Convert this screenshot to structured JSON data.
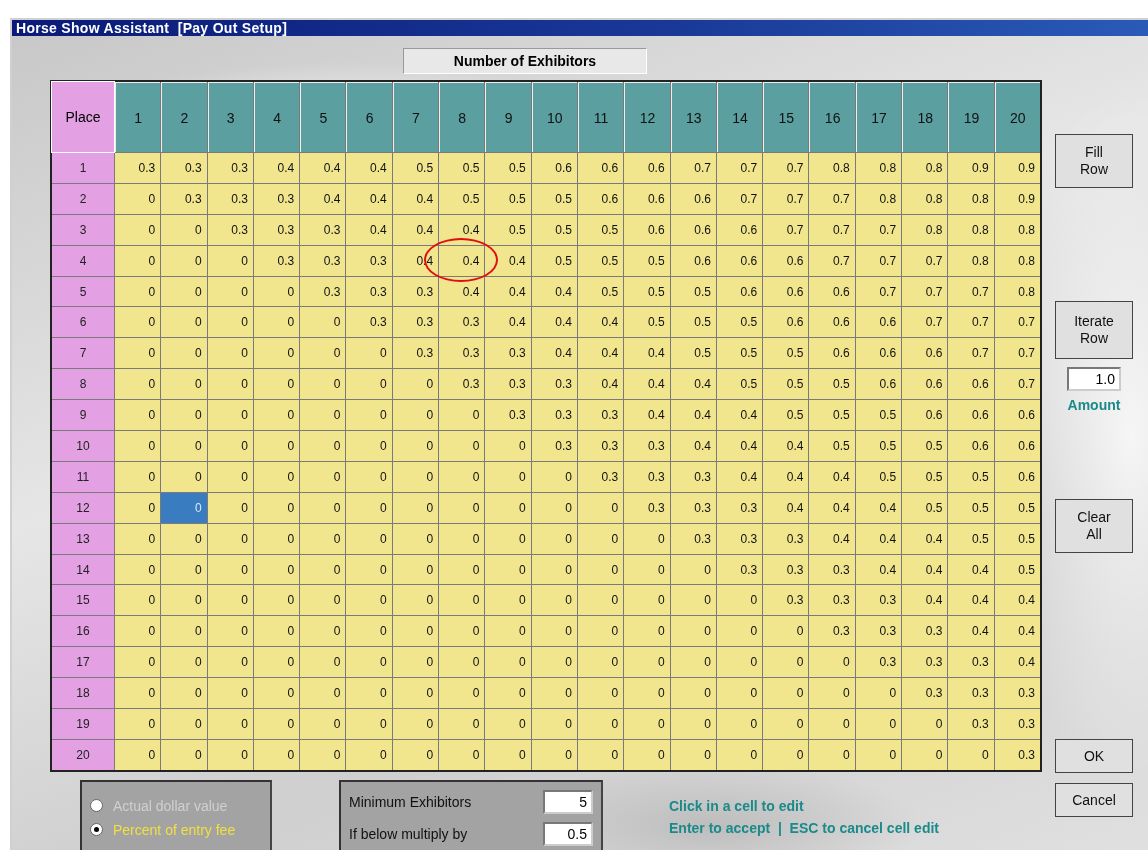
{
  "window": {
    "title": "Horse Show Assistant  [Pay Out Setup]"
  },
  "table": {
    "caption": "Number of Exhibitors",
    "corner": "Place",
    "columns": [
      "1",
      "2",
      "3",
      "4",
      "5",
      "6",
      "7",
      "8",
      "9",
      "10",
      "11",
      "12",
      "13",
      "14",
      "15",
      "16",
      "17",
      "18",
      "19",
      "20"
    ],
    "rows": [
      {
        "place": "1",
        "cells": [
          "0.3",
          "0.3",
          "0.3",
          "0.4",
          "0.4",
          "0.4",
          "0.5",
          "0.5",
          "0.5",
          "0.6",
          "0.6",
          "0.6",
          "0.7",
          "0.7",
          "0.7",
          "0.8",
          "0.8",
          "0.8",
          "0.9",
          "0.9"
        ],
        "selected": [
          false,
          false,
          false,
          false,
          false,
          false,
          false,
          false,
          false,
          false,
          false,
          false,
          false,
          false,
          false,
          false,
          false,
          false,
          false,
          false
        ],
        "circled": [
          false,
          false,
          false,
          false,
          false,
          false,
          false,
          false,
          false,
          false,
          false,
          false,
          false,
          false,
          false,
          false,
          false,
          false,
          false,
          false
        ]
      },
      {
        "place": "2",
        "cells": [
          "0",
          "0.3",
          "0.3",
          "0.3",
          "0.4",
          "0.4",
          "0.4",
          "0.5",
          "0.5",
          "0.5",
          "0.6",
          "0.6",
          "0.6",
          "0.7",
          "0.7",
          "0.7",
          "0.8",
          "0.8",
          "0.8",
          "0.9"
        ],
        "selected": [
          false,
          false,
          false,
          false,
          false,
          false,
          false,
          false,
          false,
          false,
          false,
          false,
          false,
          false,
          false,
          false,
          false,
          false,
          false,
          false
        ],
        "circled": [
          false,
          false,
          false,
          false,
          false,
          false,
          false,
          false,
          false,
          false,
          false,
          false,
          false,
          false,
          false,
          false,
          false,
          false,
          false,
          false
        ]
      },
      {
        "place": "3",
        "cells": [
          "0",
          "0",
          "0.3",
          "0.3",
          "0.3",
          "0.4",
          "0.4",
          "0.4",
          "0.5",
          "0.5",
          "0.5",
          "0.6",
          "0.6",
          "0.6",
          "0.7",
          "0.7",
          "0.7",
          "0.8",
          "0.8",
          "0.8"
        ],
        "selected": [
          false,
          false,
          false,
          false,
          false,
          false,
          false,
          false,
          false,
          false,
          false,
          false,
          false,
          false,
          false,
          false,
          false,
          false,
          false,
          false
        ],
        "circled": [
          false,
          false,
          false,
          false,
          false,
          false,
          false,
          false,
          false,
          false,
          false,
          false,
          false,
          false,
          false,
          false,
          false,
          false,
          false,
          false
        ]
      },
      {
        "place": "4",
        "cells": [
          "0",
          "0",
          "0",
          "0.3",
          "0.3",
          "0.3",
          "0.4",
          "0.4",
          "0.4",
          "0.5",
          "0.5",
          "0.5",
          "0.6",
          "0.6",
          "0.6",
          "0.7",
          "0.7",
          "0.7",
          "0.8",
          "0.8"
        ],
        "selected": [
          false,
          false,
          false,
          false,
          false,
          false,
          false,
          false,
          false,
          false,
          false,
          false,
          false,
          false,
          false,
          false,
          false,
          false,
          false,
          false
        ],
        "circled": [
          false,
          false,
          false,
          false,
          false,
          false,
          false,
          true,
          false,
          false,
          false,
          false,
          false,
          false,
          false,
          false,
          false,
          false,
          false,
          false
        ]
      },
      {
        "place": "5",
        "cells": [
          "0",
          "0",
          "0",
          "0",
          "0.3",
          "0.3",
          "0.3",
          "0.4",
          "0.4",
          "0.4",
          "0.5",
          "0.5",
          "0.5",
          "0.6",
          "0.6",
          "0.6",
          "0.7",
          "0.7",
          "0.7",
          "0.8"
        ],
        "selected": [
          false,
          false,
          false,
          false,
          false,
          false,
          false,
          false,
          false,
          false,
          false,
          false,
          false,
          false,
          false,
          false,
          false,
          false,
          false,
          false
        ],
        "circled": [
          false,
          false,
          false,
          false,
          false,
          false,
          false,
          false,
          false,
          false,
          false,
          false,
          false,
          false,
          false,
          false,
          false,
          false,
          false,
          false
        ]
      },
      {
        "place": "6",
        "cells": [
          "0",
          "0",
          "0",
          "0",
          "0",
          "0.3",
          "0.3",
          "0.3",
          "0.4",
          "0.4",
          "0.4",
          "0.5",
          "0.5",
          "0.5",
          "0.6",
          "0.6",
          "0.6",
          "0.7",
          "0.7",
          "0.7"
        ],
        "selected": [
          false,
          false,
          false,
          false,
          false,
          false,
          false,
          false,
          false,
          false,
          false,
          false,
          false,
          false,
          false,
          false,
          false,
          false,
          false,
          false
        ],
        "circled": [
          false,
          false,
          false,
          false,
          false,
          false,
          false,
          false,
          false,
          false,
          false,
          false,
          false,
          false,
          false,
          false,
          false,
          false,
          false,
          false
        ]
      },
      {
        "place": "7",
        "cells": [
          "0",
          "0",
          "0",
          "0",
          "0",
          "0",
          "0.3",
          "0.3",
          "0.3",
          "0.4",
          "0.4",
          "0.4",
          "0.5",
          "0.5",
          "0.5",
          "0.6",
          "0.6",
          "0.6",
          "0.7",
          "0.7"
        ],
        "selected": [
          false,
          false,
          false,
          false,
          false,
          false,
          false,
          false,
          false,
          false,
          false,
          false,
          false,
          false,
          false,
          false,
          false,
          false,
          false,
          false
        ],
        "circled": [
          false,
          false,
          false,
          false,
          false,
          false,
          false,
          false,
          false,
          false,
          false,
          false,
          false,
          false,
          false,
          false,
          false,
          false,
          false,
          false
        ]
      },
      {
        "place": "8",
        "cells": [
          "0",
          "0",
          "0",
          "0",
          "0",
          "0",
          "0",
          "0.3",
          "0.3",
          "0.3",
          "0.4",
          "0.4",
          "0.4",
          "0.5",
          "0.5",
          "0.5",
          "0.6",
          "0.6",
          "0.6",
          "0.7"
        ],
        "selected": [
          false,
          false,
          false,
          false,
          false,
          false,
          false,
          false,
          false,
          false,
          false,
          false,
          false,
          false,
          false,
          false,
          false,
          false,
          false,
          false
        ],
        "circled": [
          false,
          false,
          false,
          false,
          false,
          false,
          false,
          false,
          false,
          false,
          false,
          false,
          false,
          false,
          false,
          false,
          false,
          false,
          false,
          false
        ]
      },
      {
        "place": "9",
        "cells": [
          "0",
          "0",
          "0",
          "0",
          "0",
          "0",
          "0",
          "0",
          "0.3",
          "0.3",
          "0.3",
          "0.4",
          "0.4",
          "0.4",
          "0.5",
          "0.5",
          "0.5",
          "0.6",
          "0.6",
          "0.6"
        ],
        "selected": [
          false,
          false,
          false,
          false,
          false,
          false,
          false,
          false,
          false,
          false,
          false,
          false,
          false,
          false,
          false,
          false,
          false,
          false,
          false,
          false
        ],
        "circled": [
          false,
          false,
          false,
          false,
          false,
          false,
          false,
          false,
          false,
          false,
          false,
          false,
          false,
          false,
          false,
          false,
          false,
          false,
          false,
          false
        ]
      },
      {
        "place": "10",
        "cells": [
          "0",
          "0",
          "0",
          "0",
          "0",
          "0",
          "0",
          "0",
          "0",
          "0.3",
          "0.3",
          "0.3",
          "0.4",
          "0.4",
          "0.4",
          "0.5",
          "0.5",
          "0.5",
          "0.6",
          "0.6"
        ],
        "selected": [
          false,
          false,
          false,
          false,
          false,
          false,
          false,
          false,
          false,
          false,
          false,
          false,
          false,
          false,
          false,
          false,
          false,
          false,
          false,
          false
        ],
        "circled": [
          false,
          false,
          false,
          false,
          false,
          false,
          false,
          false,
          false,
          false,
          false,
          false,
          false,
          false,
          false,
          false,
          false,
          false,
          false,
          false
        ]
      },
      {
        "place": "11",
        "cells": [
          "0",
          "0",
          "0",
          "0",
          "0",
          "0",
          "0",
          "0",
          "0",
          "0",
          "0.3",
          "0.3",
          "0.3",
          "0.4",
          "0.4",
          "0.4",
          "0.5",
          "0.5",
          "0.5",
          "0.6"
        ],
        "selected": [
          false,
          false,
          false,
          false,
          false,
          false,
          false,
          false,
          false,
          false,
          false,
          false,
          false,
          false,
          false,
          false,
          false,
          false,
          false,
          false
        ],
        "circled": [
          false,
          false,
          false,
          false,
          false,
          false,
          false,
          false,
          false,
          false,
          false,
          false,
          false,
          false,
          false,
          false,
          false,
          false,
          false,
          false
        ]
      },
      {
        "place": "12",
        "cells": [
          "0",
          "0",
          "0",
          "0",
          "0",
          "0",
          "0",
          "0",
          "0",
          "0",
          "0",
          "0.3",
          "0.3",
          "0.3",
          "0.4",
          "0.4",
          "0.4",
          "0.5",
          "0.5",
          "0.5"
        ],
        "selected": [
          false,
          true,
          false,
          false,
          false,
          false,
          false,
          false,
          false,
          false,
          false,
          false,
          false,
          false,
          false,
          false,
          false,
          false,
          false,
          false
        ],
        "circled": [
          false,
          false,
          false,
          false,
          false,
          false,
          false,
          false,
          false,
          false,
          false,
          false,
          false,
          false,
          false,
          false,
          false,
          false,
          false,
          false
        ]
      },
      {
        "place": "13",
        "cells": [
          "0",
          "0",
          "0",
          "0",
          "0",
          "0",
          "0",
          "0",
          "0",
          "0",
          "0",
          "0",
          "0.3",
          "0.3",
          "0.3",
          "0.4",
          "0.4",
          "0.4",
          "0.5",
          "0.5"
        ],
        "selected": [
          false,
          false,
          false,
          false,
          false,
          false,
          false,
          false,
          false,
          false,
          false,
          false,
          false,
          false,
          false,
          false,
          false,
          false,
          false,
          false
        ],
        "circled": [
          false,
          false,
          false,
          false,
          false,
          false,
          false,
          false,
          false,
          false,
          false,
          false,
          false,
          false,
          false,
          false,
          false,
          false,
          false,
          false
        ]
      },
      {
        "place": "14",
        "cells": [
          "0",
          "0",
          "0",
          "0",
          "0",
          "0",
          "0",
          "0",
          "0",
          "0",
          "0",
          "0",
          "0",
          "0.3",
          "0.3",
          "0.3",
          "0.4",
          "0.4",
          "0.4",
          "0.5"
        ],
        "selected": [
          false,
          false,
          false,
          false,
          false,
          false,
          false,
          false,
          false,
          false,
          false,
          false,
          false,
          false,
          false,
          false,
          false,
          false,
          false,
          false
        ],
        "circled": [
          false,
          false,
          false,
          false,
          false,
          false,
          false,
          false,
          false,
          false,
          false,
          false,
          false,
          false,
          false,
          false,
          false,
          false,
          false,
          false
        ]
      },
      {
        "place": "15",
        "cells": [
          "0",
          "0",
          "0",
          "0",
          "0",
          "0",
          "0",
          "0",
          "0",
          "0",
          "0",
          "0",
          "0",
          "0",
          "0.3",
          "0.3",
          "0.3",
          "0.4",
          "0.4",
          "0.4"
        ],
        "selected": [
          false,
          false,
          false,
          false,
          false,
          false,
          false,
          false,
          false,
          false,
          false,
          false,
          false,
          false,
          false,
          false,
          false,
          false,
          false,
          false
        ],
        "circled": [
          false,
          false,
          false,
          false,
          false,
          false,
          false,
          false,
          false,
          false,
          false,
          false,
          false,
          false,
          false,
          false,
          false,
          false,
          false,
          false
        ]
      },
      {
        "place": "16",
        "cells": [
          "0",
          "0",
          "0",
          "0",
          "0",
          "0",
          "0",
          "0",
          "0",
          "0",
          "0",
          "0",
          "0",
          "0",
          "0",
          "0.3",
          "0.3",
          "0.3",
          "0.4",
          "0.4"
        ],
        "selected": [
          false,
          false,
          false,
          false,
          false,
          false,
          false,
          false,
          false,
          false,
          false,
          false,
          false,
          false,
          false,
          false,
          false,
          false,
          false,
          false
        ],
        "circled": [
          false,
          false,
          false,
          false,
          false,
          false,
          false,
          false,
          false,
          false,
          false,
          false,
          false,
          false,
          false,
          false,
          false,
          false,
          false,
          false
        ]
      },
      {
        "place": "17",
        "cells": [
          "0",
          "0",
          "0",
          "0",
          "0",
          "0",
          "0",
          "0",
          "0",
          "0",
          "0",
          "0",
          "0",
          "0",
          "0",
          "0",
          "0.3",
          "0.3",
          "0.3",
          "0.4"
        ],
        "selected": [
          false,
          false,
          false,
          false,
          false,
          false,
          false,
          false,
          false,
          false,
          false,
          false,
          false,
          false,
          false,
          false,
          false,
          false,
          false,
          false
        ],
        "circled": [
          false,
          false,
          false,
          false,
          false,
          false,
          false,
          false,
          false,
          false,
          false,
          false,
          false,
          false,
          false,
          false,
          false,
          false,
          false,
          false
        ]
      },
      {
        "place": "18",
        "cells": [
          "0",
          "0",
          "0",
          "0",
          "0",
          "0",
          "0",
          "0",
          "0",
          "0",
          "0",
          "0",
          "0",
          "0",
          "0",
          "0",
          "0",
          "0.3",
          "0.3",
          "0.3"
        ],
        "selected": [
          false,
          false,
          false,
          false,
          false,
          false,
          false,
          false,
          false,
          false,
          false,
          false,
          false,
          false,
          false,
          false,
          false,
          false,
          false,
          false
        ],
        "circled": [
          false,
          false,
          false,
          false,
          false,
          false,
          false,
          false,
          false,
          false,
          false,
          false,
          false,
          false,
          false,
          false,
          false,
          false,
          false,
          false
        ]
      },
      {
        "place": "19",
        "cells": [
          "0",
          "0",
          "0",
          "0",
          "0",
          "0",
          "0",
          "0",
          "0",
          "0",
          "0",
          "0",
          "0",
          "0",
          "0",
          "0",
          "0",
          "0",
          "0.3",
          "0.3"
        ],
        "selected": [
          false,
          false,
          false,
          false,
          false,
          false,
          false,
          false,
          false,
          false,
          false,
          false,
          false,
          false,
          false,
          false,
          false,
          false,
          false,
          false
        ],
        "circled": [
          false,
          false,
          false,
          false,
          false,
          false,
          false,
          false,
          false,
          false,
          false,
          false,
          false,
          false,
          false,
          false,
          false,
          false,
          false,
          false
        ]
      },
      {
        "place": "20",
        "cells": [
          "0",
          "0",
          "0",
          "0",
          "0",
          "0",
          "0",
          "0",
          "0",
          "0",
          "0",
          "0",
          "0",
          "0",
          "0",
          "0",
          "0",
          "0",
          "0",
          "0.3"
        ],
        "selected": [
          false,
          false,
          false,
          false,
          false,
          false,
          false,
          false,
          false,
          false,
          false,
          false,
          false,
          false,
          false,
          false,
          false,
          false,
          false,
          false
        ],
        "circled": [
          false,
          false,
          false,
          false,
          false,
          false,
          false,
          false,
          false,
          false,
          false,
          false,
          false,
          false,
          false,
          false,
          false,
          false,
          false,
          false
        ]
      }
    ]
  },
  "sidebar": {
    "fill_row_button": "Fill Row",
    "iterate_row_button": "Iterate Row",
    "amount": {
      "value": "1.0",
      "label": "Amount"
    },
    "clear_all_button": "Clear All",
    "ok_button": "OK",
    "cancel_button": "Cancel"
  },
  "value_mode": [
    {
      "label": "Actual dollar value",
      "selected": false
    },
    {
      "label": "Percent of entry fee",
      "selected": true
    }
  ],
  "minimum": [
    {
      "label": "Minimum Exhibitors",
      "value": "5"
    },
    {
      "label": "If below multiply by",
      "value": "0.5"
    }
  ],
  "instructions": [
    "Click in a cell to edit",
    "Enter to accept  |  ESC to cancel cell edit"
  ]
}
